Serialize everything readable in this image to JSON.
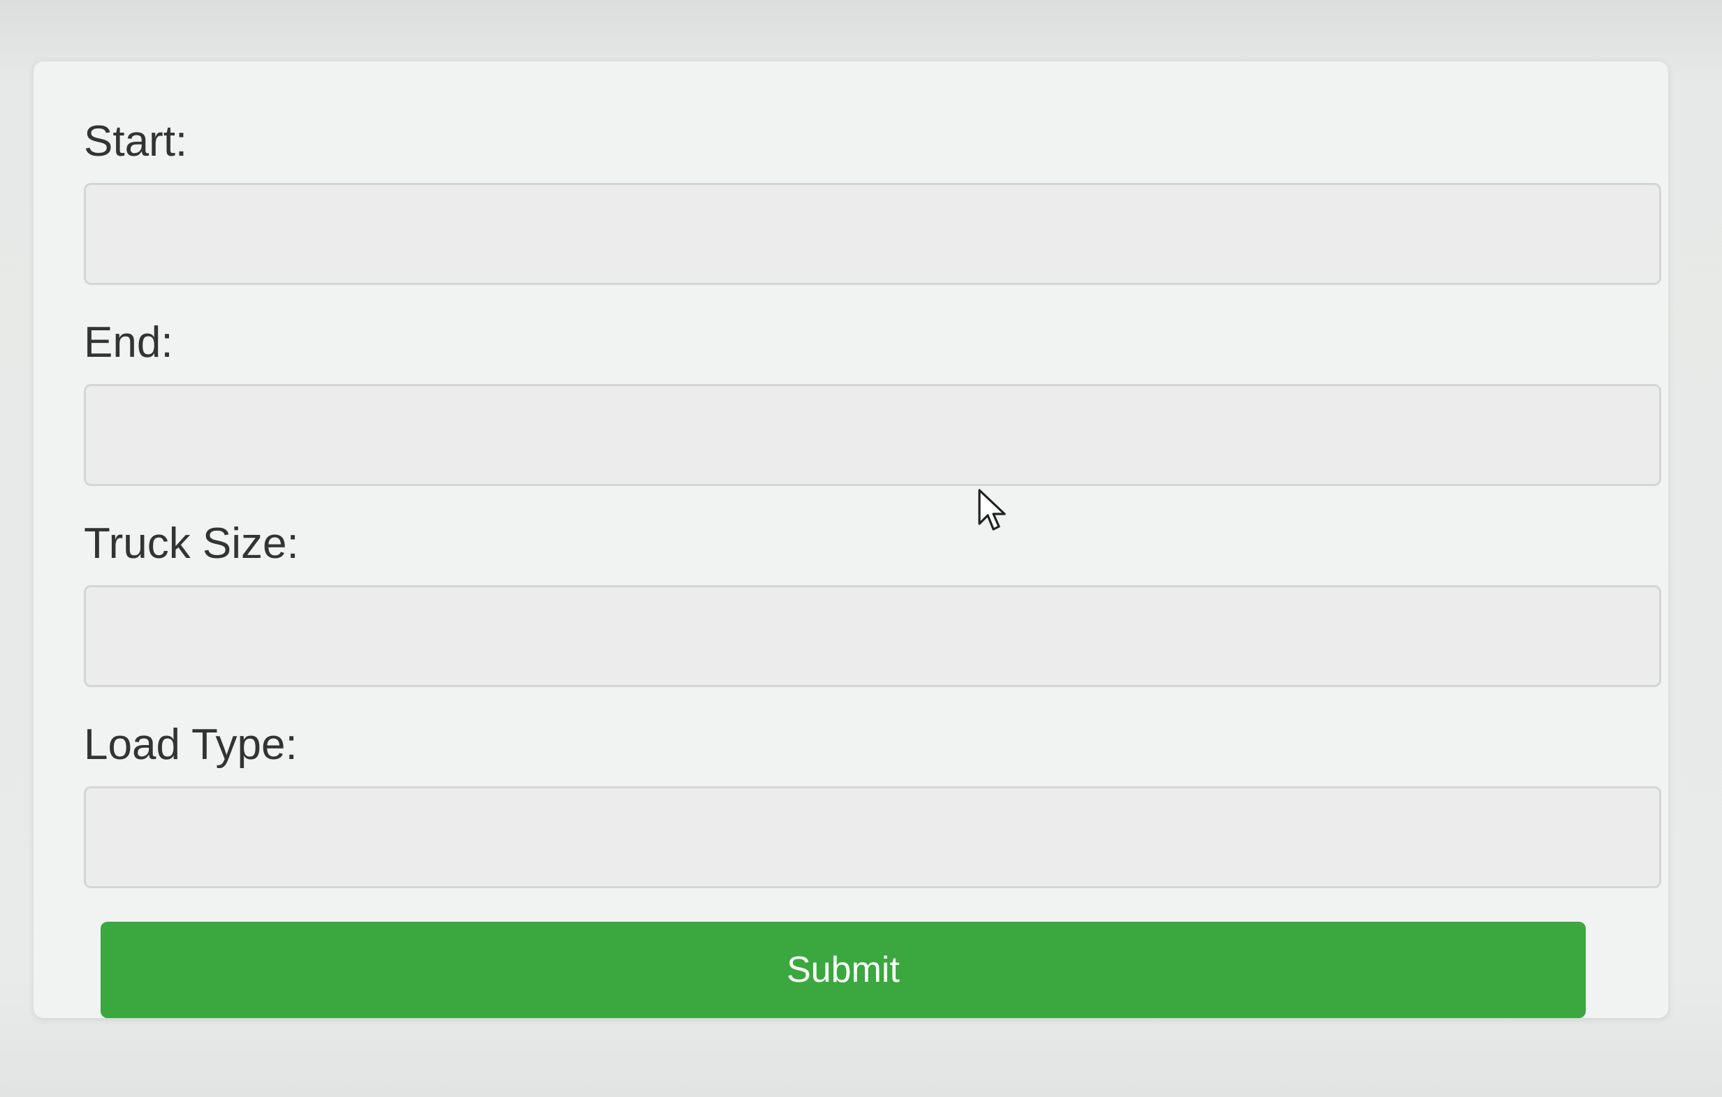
{
  "form": {
    "fields": [
      {
        "label": "Start:",
        "value": "",
        "placeholder": ""
      },
      {
        "label": "End:",
        "value": "",
        "placeholder": ""
      },
      {
        "label": "Truck Size:",
        "value": "",
        "placeholder": ""
      },
      {
        "label": "Load Type:",
        "value": "",
        "placeholder": ""
      }
    ],
    "submit_label": "Submit"
  },
  "colors": {
    "accent": "#3aa83f",
    "card_background": "#f1f2f2",
    "input_background": "#ececec",
    "label_text": "#333333"
  },
  "icons": {
    "cursor": "mouse-pointer-icon"
  }
}
